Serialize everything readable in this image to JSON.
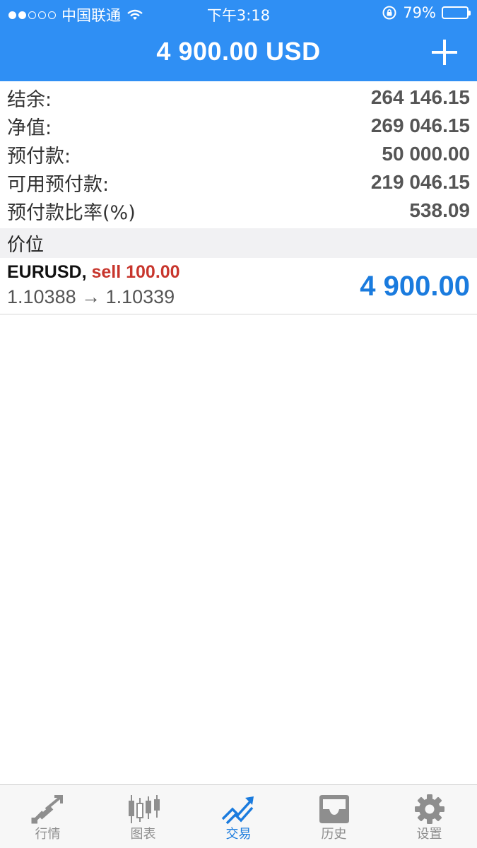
{
  "status_bar": {
    "carrier": "中国联通",
    "time": "下午3:18",
    "battery_percent": "79%",
    "battery_level": 0.79,
    "signal_bars_filled": 2,
    "signal_bars_total": 5
  },
  "header": {
    "title": "4 900.00 USD",
    "add_icon": "plus-icon",
    "background_color": "#2f8ff4"
  },
  "summary": {
    "balance_label": "结余:",
    "balance_value": "264 146.15",
    "equity_label": "净值:",
    "equity_value": "269 046.15",
    "margin_label": "预付款:",
    "margin_value": "50 000.00",
    "free_margin_label": "可用预付款:",
    "free_margin_value": "219 046.15",
    "margin_level_label": "预付款比率(%)",
    "margin_level_value": "538.09"
  },
  "positions_section": {
    "title": "价位"
  },
  "position": {
    "symbol": "EURUSD,",
    "trade": "sell 100.00",
    "prices": "1.10388 → 1.10339",
    "profit": "4 900.00",
    "trade_color": "#c8362d",
    "profit_color": "#1a7bde"
  },
  "tabs": [
    {
      "label": "行情",
      "icon": "quotes-arrows-icon",
      "active": false
    },
    {
      "label": "图表",
      "icon": "candlestick-chart-icon",
      "active": false
    },
    {
      "label": "交易",
      "icon": "trade-trend-icon",
      "active": true
    },
    {
      "label": "历史",
      "icon": "history-inbox-icon",
      "active": false
    },
    {
      "label": "设置",
      "icon": "gear-icon",
      "active": false
    }
  ],
  "colors": {
    "accent": "#1a7bde",
    "inactive_tab": "#8e8e8e"
  }
}
